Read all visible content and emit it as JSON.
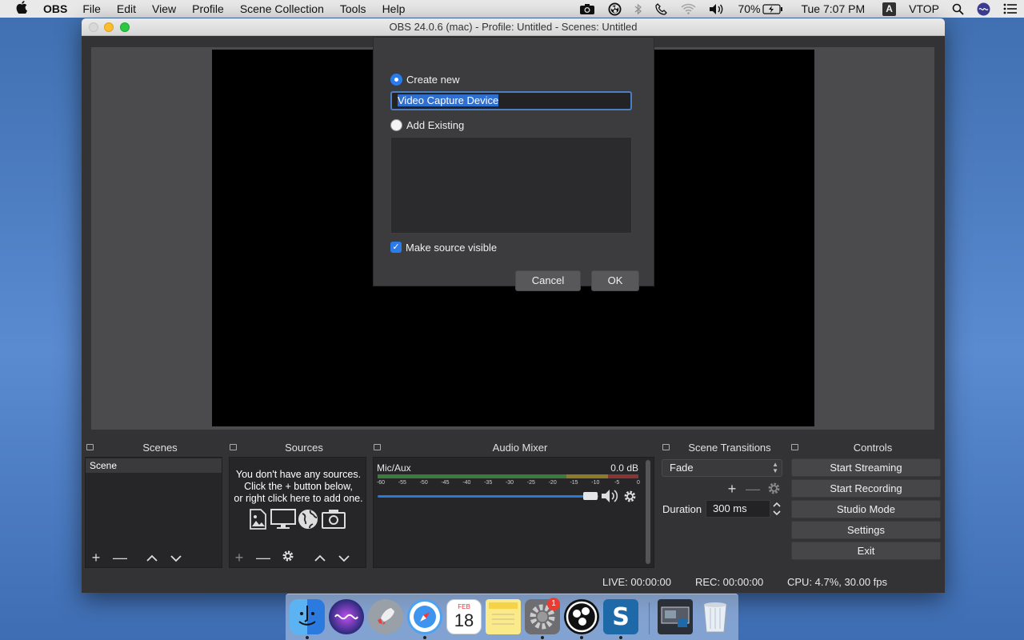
{
  "menubar": {
    "app_name": "OBS",
    "menus": [
      "File",
      "Edit",
      "View",
      "Profile",
      "Scene Collection",
      "Tools",
      "Help"
    ],
    "battery": "70%",
    "clock": "Tue 7:07 PM",
    "input_source": "A",
    "user": "VTOP"
  },
  "window": {
    "title": "OBS 24.0.6 (mac) - Profile: Untitled - Scenes: Untitled"
  },
  "dialog": {
    "create_new_label": "Create new",
    "name_value": "Video Capture Device",
    "add_existing_label": "Add Existing",
    "visible_label": "Make source visible",
    "cancel_label": "Cancel",
    "ok_label": "OK"
  },
  "docks": {
    "scenes": {
      "title": "Scenes",
      "items": [
        "Scene"
      ]
    },
    "sources": {
      "title": "Sources",
      "empty_line1": "You don't have any sources.",
      "empty_line2": "Click the + button below,",
      "empty_line3": "or right click here to add one."
    },
    "mixer": {
      "title": "Audio Mixer",
      "channel_name": "Mic/Aux",
      "channel_db": "0.0 dB",
      "ticks": [
        "-60",
        "-55",
        "-50",
        "-45",
        "-40",
        "-35",
        "-30",
        "-25",
        "-20",
        "-15",
        "-10",
        "-5",
        "0"
      ],
      "volume_level": 1.0
    },
    "transitions": {
      "title": "Scene Transitions",
      "selected": "Fade",
      "duration_label": "Duration",
      "duration_value": "300 ms"
    },
    "controls": {
      "title": "Controls",
      "buttons": [
        "Start Streaming",
        "Start Recording",
        "Studio Mode",
        "Settings",
        "Exit"
      ]
    }
  },
  "status": {
    "live": "LIVE: 00:00:00",
    "rec": "REC: 00:00:00",
    "cpu": "CPU: 4.7%, 30.00 fps"
  },
  "mac_dock": {
    "calendar_month": "FEB",
    "calendar_day": "18",
    "prefs_badge": "1"
  },
  "colors": {
    "accent": "#2b7be9",
    "window_bg": "#333336",
    "panel_bg": "#262628"
  }
}
